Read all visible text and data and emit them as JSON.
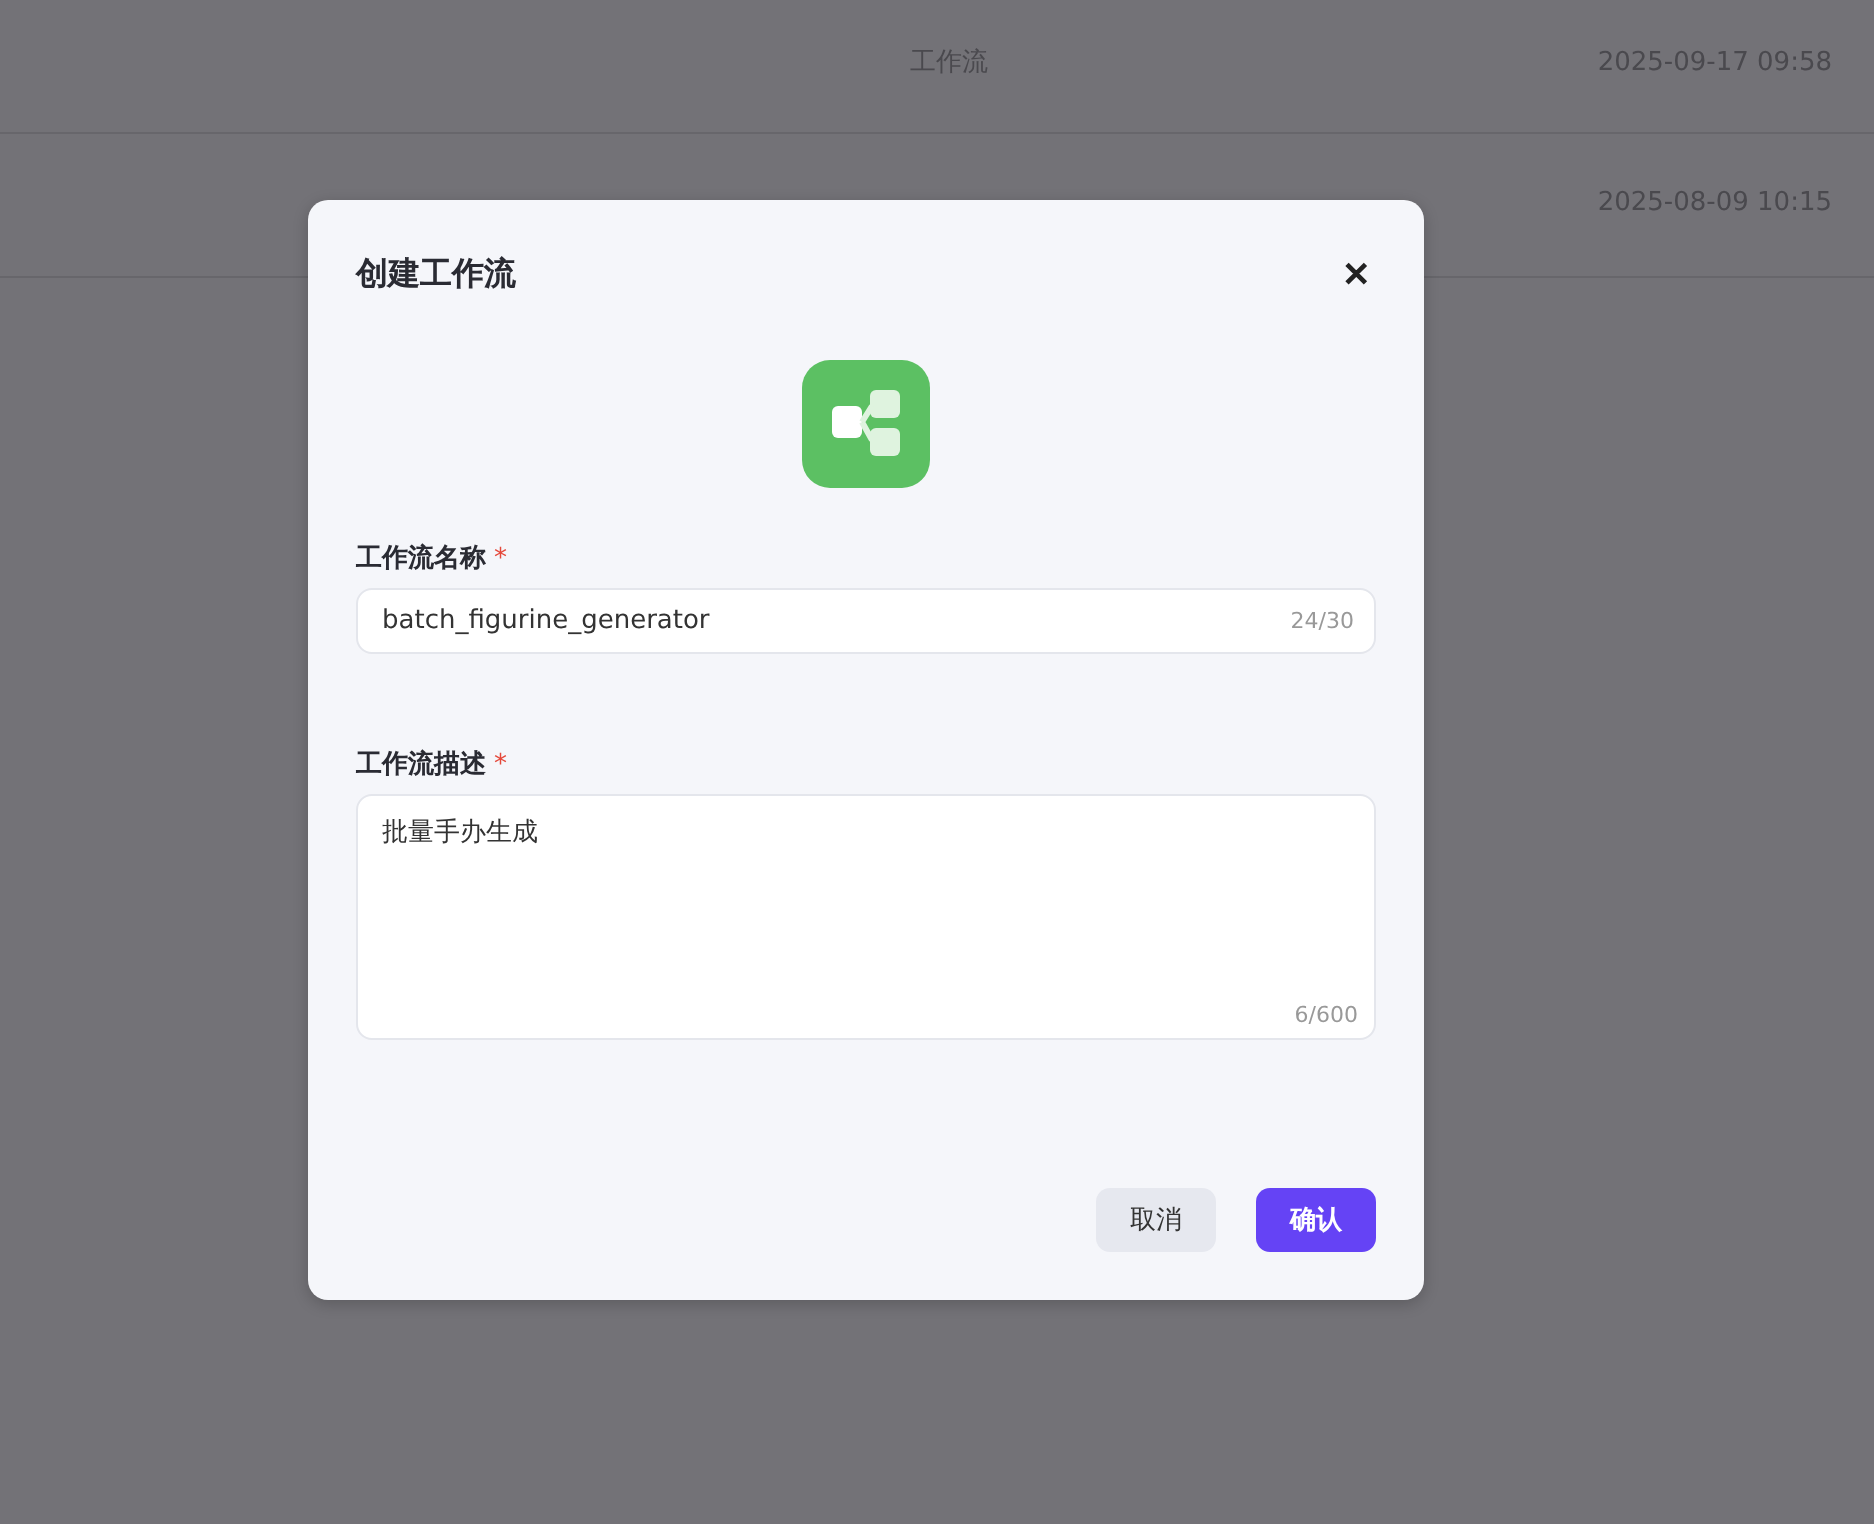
{
  "background_rows": [
    {
      "type": "工作流",
      "time": "2025-09-17 09:58"
    },
    {
      "time": "2025-08-09 10:15"
    }
  ],
  "dialog": {
    "title": "创建工作流",
    "close": "✕",
    "fields": [
      {
        "kind": "input",
        "label": "工作流名称",
        "required_mark": "*",
        "value": "batch_figurine_generator",
        "count": "24/30"
      },
      {
        "kind": "textarea",
        "label": "工作流描述",
        "required_mark": "*",
        "value": "批量手办生成",
        "count": "6/600"
      }
    ],
    "buttons": [
      {
        "label": "取消",
        "primary": false
      },
      {
        "label": "确认",
        "primary": true
      }
    ]
  }
}
